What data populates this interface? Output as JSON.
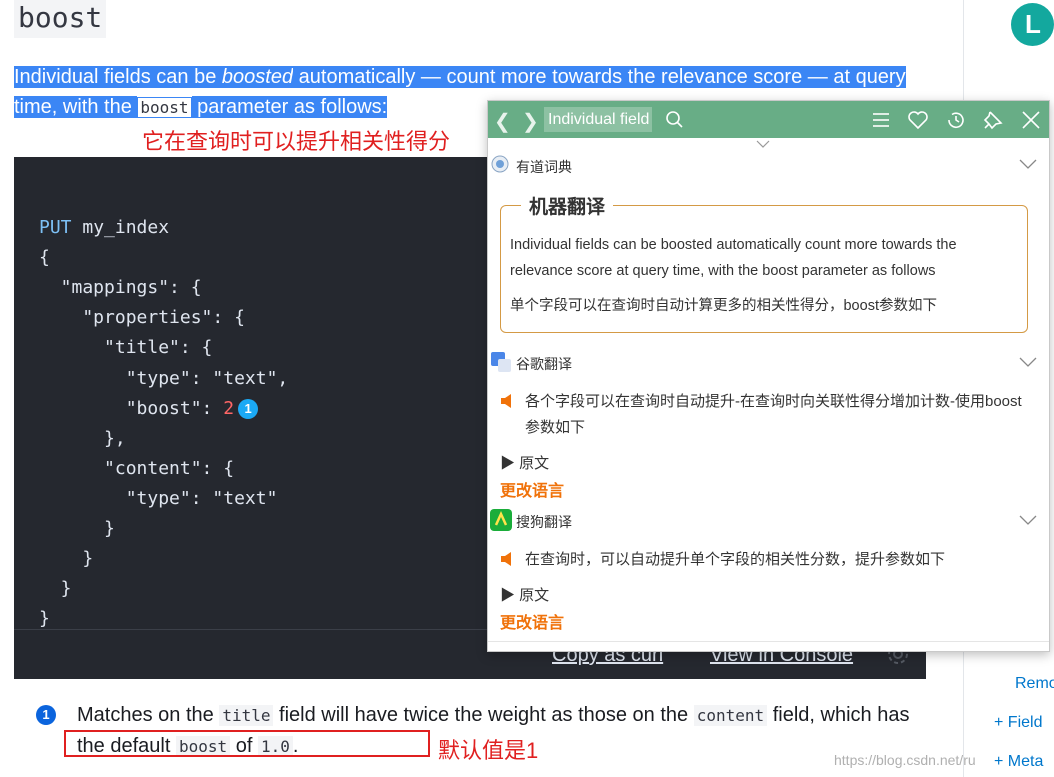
{
  "page": {
    "title": "boost",
    "intro_part1": "Individual fields can be ",
    "intro_em": "boosted",
    "intro_part2": " automatically — count more towards the relevance score — at query time, with the ",
    "intro_code": "boost",
    "intro_part3": " parameter as follows:",
    "note_boost": "它在查询时可以提升相关性得分",
    "note_default": "默认值是1"
  },
  "code": {
    "lines": [
      {
        "kw": "PUT",
        "rest": " my_index"
      },
      {
        "text": "{"
      },
      {
        "text": "  \"mappings\": {"
      },
      {
        "text": "    \"properties\": {"
      },
      {
        "text": "      \"title\": {"
      },
      {
        "text": "        \"type\": \"text\","
      },
      {
        "pre": "        \"boost\": ",
        "num": "2",
        "callout": "1"
      },
      {
        "text": "      },"
      },
      {
        "text": "      \"content\": {"
      },
      {
        "text": "        \"type\": \"text\""
      },
      {
        "text": "      }"
      },
      {
        "text": "    }"
      },
      {
        "text": "  }"
      },
      {
        "text": "}"
      }
    ],
    "copy_curl": "Copy as curl",
    "view_console": "View in Console"
  },
  "description": {
    "callout": "1",
    "t1": "Matches on the ",
    "c1": "title",
    "t2": " field will have twice the weight as those on the ",
    "c2": "content",
    "t3": " field, which has the default ",
    "c3": "boost",
    "t4": " of ",
    "c4": "1.0",
    "t5": "."
  },
  "sidebar": {
    "logo": "L",
    "items": [
      "Remo",
      "+ Field",
      "+ Meta"
    ]
  },
  "watermark": "https://blog.csdn.net/ru",
  "popup": {
    "query": "Individual field",
    "icons": [
      "back-icon",
      "forward-icon",
      "search-icon",
      "menu-icon",
      "heart-icon",
      "history-icon",
      "pin-icon",
      "close-icon"
    ],
    "youdao": {
      "title": "有道词典",
      "mt_title": "机器翻译",
      "mt_source": "Individual fields can be boosted automatically count more towards the relevance score at query time, with the boost parameter as follows",
      "mt_target": "单个字段可以在查询时自动计算更多的相关性得分，boost参数如下"
    },
    "google": {
      "title": "谷歌翻译",
      "translation": "各个字段可以在查询时自动提升-在查询时向关联性得分增加计数-使用boost参数如下",
      "original": "▶ 原文",
      "change_lang": "更改语言"
    },
    "sogou": {
      "title": "搜狗翻译",
      "translation": "在查询时，可以自动提升单个字段的相关性分数，提升参数如下",
      "original": "▶ 原文",
      "change_lang": "更改语言"
    }
  },
  "colors": {
    "highlight": "#3b86f5",
    "code_bg": "#25282f",
    "popup_header": "#68ad86",
    "accent_orange": "#f0720a",
    "annotation_red": "#e02020"
  }
}
